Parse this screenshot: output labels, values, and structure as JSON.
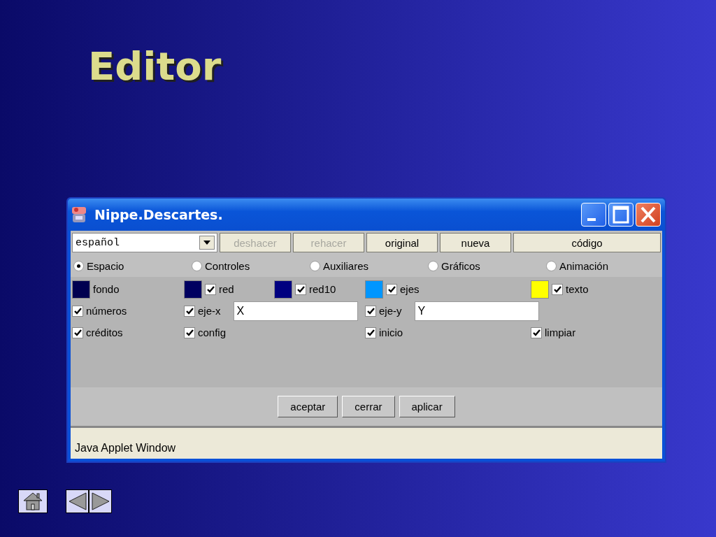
{
  "slide": {
    "title": "Editor"
  },
  "window": {
    "title": "Nippe.Descartes."
  },
  "toolbar": {
    "language": "español",
    "buttons": [
      {
        "label": "deshacer",
        "disabled": true
      },
      {
        "label": "rehacer",
        "disabled": true
      },
      {
        "label": "original",
        "disabled": false
      },
      {
        "label": "nueva",
        "disabled": false
      },
      {
        "label": "código",
        "disabled": false
      }
    ]
  },
  "modes": [
    {
      "label": "Espacio",
      "selected": true
    },
    {
      "label": "Controles",
      "selected": false
    },
    {
      "label": "Auxiliares",
      "selected": false
    },
    {
      "label": "Gráficos",
      "selected": false
    },
    {
      "label": "Animación",
      "selected": false
    }
  ],
  "option_rows": [
    [
      [
        {
          "kind": "color",
          "color": "#000050",
          "label": "fondo"
        }
      ],
      [
        {
          "kind": "color_check",
          "color": "#000060",
          "checked": true,
          "label": "red"
        },
        {
          "kind": "color_check",
          "color": "#000080",
          "checked": true,
          "label": "red10"
        }
      ],
      [
        {
          "kind": "color_check",
          "color": "#0096ff",
          "checked": true,
          "label": "ejes"
        }
      ],
      [
        {
          "kind": "color_check",
          "color": "#ffff00",
          "checked": true,
          "label": "texto"
        }
      ]
    ],
    [
      [
        {
          "kind": "check",
          "checked": true,
          "label": "números"
        }
      ],
      [
        {
          "kind": "check_field",
          "checked": true,
          "label": "eje-x",
          "value": "X"
        }
      ],
      [
        {
          "kind": "check_field",
          "checked": true,
          "label": "eje-y",
          "value": "Y"
        }
      ],
      []
    ],
    [
      [
        {
          "kind": "check",
          "checked": true,
          "label": "créditos"
        }
      ],
      [
        {
          "kind": "check",
          "checked": true,
          "label": "config"
        }
      ],
      [
        {
          "kind": "check",
          "checked": true,
          "label": "inicio"
        }
      ],
      [
        {
          "kind": "check",
          "checked": true,
          "label": "limpiar"
        }
      ]
    ]
  ],
  "actions": [
    "aceptar",
    "cerrar",
    "aplicar"
  ],
  "status_bar": "Java Applet Window"
}
